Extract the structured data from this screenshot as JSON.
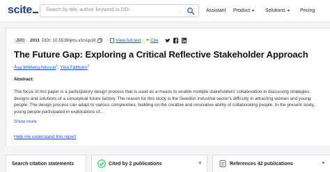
{
  "header": {
    "logo": "scite",
    "search_placeholder": "Search by title, author, keyword or DOI",
    "nav": {
      "assistant": "Assistant",
      "product": "Product",
      "solutions": "Solutions",
      "pricing": "Pricing"
    }
  },
  "article": {
    "journal_badge": "JMS",
    "year": "2011",
    "doi": "DOI: 10.5539/jms.v1n1p18",
    "full_text_link": "View full text",
    "cite_link": "Cite",
    "title": "The Future Gap: Exploring a Critical Reflective Stakeholder Approach",
    "authors": [
      {
        "name": "Åsa Wikberg-Nilsson",
        "sup": "1"
      },
      {
        "name": "Ylva Fältholm",
        "sup": "2"
      }
    ],
    "abstract_label": "Abstract:",
    "abstract_lines": [
      "The focus of this paper is a participatory design process that is used as a means to enable multiple stakeholders' collaboration in discussing strategies,",
      "designs and solutions of a conceptual future factory. The reason for this study is the Swedish industrial sector's difficulty in attracting women and young",
      "people. The design process can adapt to various complexities, building on the creative and innovative ability of collaborating people. In the present study,",
      "young people participated in explorations of..."
    ],
    "show_more": "Show more",
    "help_link": "Help me understand this report"
  },
  "panels": {
    "citation_search": "Search citation statements",
    "cited_by": "Cited by 2 publications",
    "references": "References 42 publications"
  },
  "colors": {
    "brand": "#1e3a8a",
    "link": "#1d4ed8",
    "cited_icon": "#22c55e"
  }
}
